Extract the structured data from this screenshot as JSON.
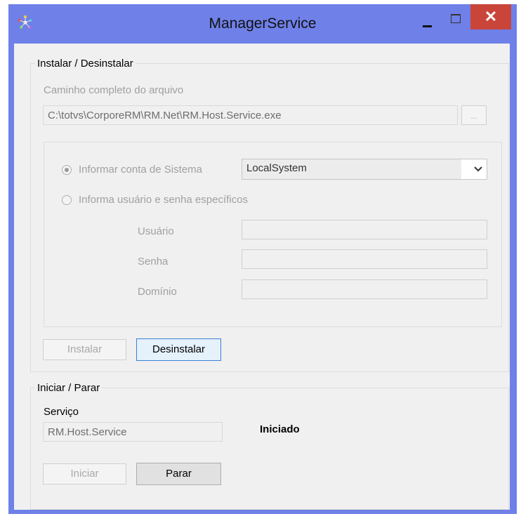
{
  "window": {
    "title": "ManagerService"
  },
  "install_group": {
    "legend": "Instalar / Desinstalar",
    "path_label": "Caminho completo do arquivo",
    "path_value": "C:\\totvs\\CorporeRM\\RM.Net\\RM.Host.Service.exe",
    "browse_label": "...",
    "radio_system_label": "Informar conta de Sistema",
    "radio_user_label": "Informa usuário e senha específicos",
    "account_select_value": "LocalSystem",
    "user_label": "Usuário",
    "password_label": "Senha",
    "domain_label": "Domínio",
    "install_button": "Instalar",
    "uninstall_button": "Desinstalar"
  },
  "service_group": {
    "legend": "Iniciar / Parar",
    "service_label": "Serviço",
    "service_value": "RM.Host.Service",
    "status": "Iniciado",
    "start_button": "Iniciar",
    "stop_button": "Parar"
  }
}
